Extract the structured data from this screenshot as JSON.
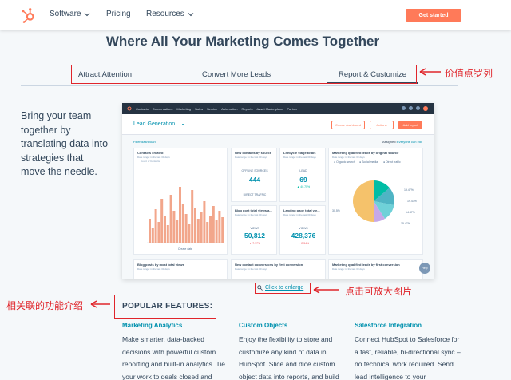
{
  "nav": {
    "logo": "hubspot-sprocket-icon",
    "items": [
      {
        "label": "Software",
        "has_dropdown": true
      },
      {
        "label": "Pricing",
        "has_dropdown": false
      },
      {
        "label": "Resources",
        "has_dropdown": true
      }
    ],
    "cta": "Get started"
  },
  "headline": "Where All Your Marketing Comes Together",
  "tabs": [
    {
      "label": "Attract Attention",
      "active": false
    },
    {
      "label": "Convert More Leads",
      "active": false
    },
    {
      "label": "Report & Customize",
      "active": true
    }
  ],
  "annotations": {
    "tabs_note": "价值点罗列",
    "enlarge_note": "点击可放大图片",
    "features_note": "相关联的功能介绍"
  },
  "lead_copy": "Bring your team together by translating data into strategies that move the needle.",
  "dashboard": {
    "menu": [
      "Contacts",
      "Conversations",
      "Marketing",
      "Sales",
      "Service",
      "Automation",
      "Reports",
      "Asset Marketplace",
      "Partner"
    ],
    "title": "Lead Generation",
    "create_button": "Create dashboard",
    "actions_button": "Actions",
    "add_button": "Add report",
    "filter_link": "Filter dashboard",
    "assigned": "Assigned:",
    "assigned_value": "Everyone can edit",
    "cards": {
      "contacts_created": {
        "title": "Contacts created",
        "sub": "Date range: in the last 30 days",
        "legend": "Count of Contacts",
        "xlabel": "Create date",
        "ylabel": "Count of Contacts"
      },
      "new_contacts": {
        "title": "New contacts by source",
        "sub": "Date range: in the last 30 days",
        "label1": "OFFLINE SOURCES",
        "value1": "444",
        "label2": "DIRECT TRAFFIC"
      },
      "lifecycle": {
        "title": "Lifecycle stage totals",
        "sub": "Date range: in the last 30 days",
        "label": "LEAD",
        "value": "69",
        "change": "▲ 40.75%"
      },
      "blog_views": {
        "title": "Blog post total views a...",
        "sub": "Date range: in the last 30 days",
        "label": "VIEWS",
        "value": "50,812",
        "change": "▼ 7.77%"
      },
      "landing_views": {
        "title": "Landing page total vie...",
        "sub": "Date range: in the last 30 days",
        "label": "VIEWS",
        "value": "428,376",
        "change": "▼ 2.34%"
      },
      "mql": {
        "title": "Marketing qualified leads by original source",
        "sub": "Date range: in the last 30 days",
        "legend": [
          "Organic search",
          "Social media",
          "Direct traffic"
        ],
        "left_label": "30.5%",
        "right_labels": [
          "19.47%",
          "19.47%",
          "14.47%",
          "15.47%"
        ]
      },
      "blog_most_views": {
        "title": "Blog posts by most total views",
        "sub": "Date range: in the last 30 days"
      },
      "new_conversions": {
        "title": "New contact conversions by first conversion",
        "sub": "Date range: in the last 30 days"
      },
      "mql_first": {
        "title": "Marketing qualified leads by first conversion",
        "sub": "Date range: in the last 30 days"
      }
    },
    "help": "Help"
  },
  "enlarge": {
    "icon": "magnifier-icon",
    "label": "Click to enlarge"
  },
  "features": {
    "title": "POPULAR FEATURES:",
    "items": [
      {
        "heading": "Marketing Analytics",
        "body": "Make smarter, data-backed decisions with powerful custom reporting and built-in analytics. Tie your work to deals closed and"
      },
      {
        "heading": "Custom Objects",
        "body": "Enjoy the flexibility to store and customize any kind of data in HubSpot. Slice and dice custom object data into reports, and build"
      },
      {
        "heading": "Salesforce Integration",
        "body": "Connect HubSpot to Salesforce for a fast, reliable, bi-directional sync – no technical work required. Send lead intelligence to your"
      }
    ]
  },
  "colors": {
    "accent": "#ff7a59",
    "link": "#0091ae",
    "annotation": "#e0252b",
    "text": "#33475b"
  }
}
